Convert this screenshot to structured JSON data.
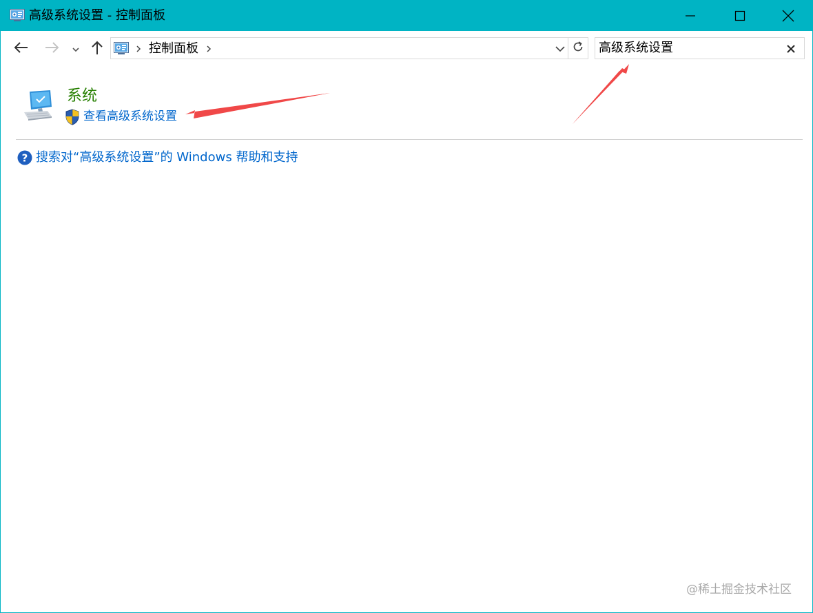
{
  "window": {
    "title": "高级系统设置 - 控制面板",
    "accent_color": "#00b4c4"
  },
  "titlebar": {
    "app_icon": "control-panel-icon",
    "minimize_icon": "minimize-icon",
    "maximize_icon": "maximize-icon",
    "close_icon": "close-icon"
  },
  "navigation": {
    "back_icon": "arrow-left-icon",
    "forward_icon": "arrow-right-icon",
    "recent_icon": "chevron-down-icon",
    "up_icon": "arrow-up-icon"
  },
  "address_bar": {
    "location_icon": "control-panel-icon",
    "breadcrumb": "控制面板",
    "dropdown_icon": "chevron-down-icon",
    "refresh_icon": "refresh-icon"
  },
  "search": {
    "value": "高级系统设置",
    "clear_icon": "close-icon"
  },
  "results": {
    "category_title": "系统",
    "category_icon": "computer-monitor-icon",
    "task_link": "查看高级系统设置",
    "task_icon": "uac-shield-icon",
    "link_color": "#0066cc",
    "title_color": "#267f00"
  },
  "help": {
    "icon": "help-icon",
    "link_text": "搜索对“高级系统设置”的 Windows 帮助和支持"
  },
  "annotations": {
    "arrow_color": "#f04848"
  },
  "watermark": {
    "text": "@稀土掘金技术社区"
  }
}
